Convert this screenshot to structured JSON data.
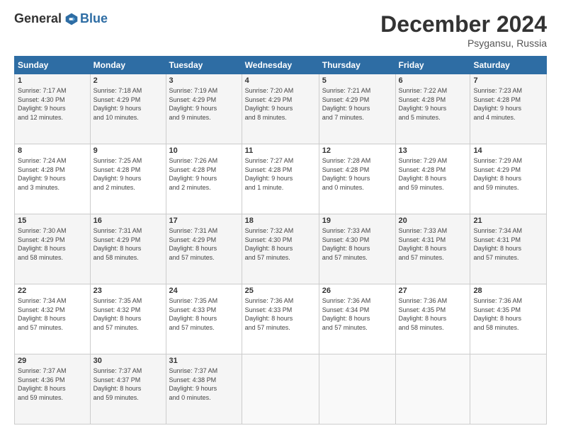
{
  "logo": {
    "general": "General",
    "blue": "Blue"
  },
  "header": {
    "month": "December 2024",
    "location": "Psygansu, Russia"
  },
  "weekdays": [
    "Sunday",
    "Monday",
    "Tuesday",
    "Wednesday",
    "Thursday",
    "Friday",
    "Saturday"
  ],
  "weeks": [
    [
      {
        "day": "1",
        "info": "Sunrise: 7:17 AM\nSunset: 4:30 PM\nDaylight: 9 hours\nand 12 minutes."
      },
      {
        "day": "2",
        "info": "Sunrise: 7:18 AM\nSunset: 4:29 PM\nDaylight: 9 hours\nand 10 minutes."
      },
      {
        "day": "3",
        "info": "Sunrise: 7:19 AM\nSunset: 4:29 PM\nDaylight: 9 hours\nand 9 minutes."
      },
      {
        "day": "4",
        "info": "Sunrise: 7:20 AM\nSunset: 4:29 PM\nDaylight: 9 hours\nand 8 minutes."
      },
      {
        "day": "5",
        "info": "Sunrise: 7:21 AM\nSunset: 4:29 PM\nDaylight: 9 hours\nand 7 minutes."
      },
      {
        "day": "6",
        "info": "Sunrise: 7:22 AM\nSunset: 4:28 PM\nDaylight: 9 hours\nand 5 minutes."
      },
      {
        "day": "7",
        "info": "Sunrise: 7:23 AM\nSunset: 4:28 PM\nDaylight: 9 hours\nand 4 minutes."
      }
    ],
    [
      {
        "day": "8",
        "info": "Sunrise: 7:24 AM\nSunset: 4:28 PM\nDaylight: 9 hours\nand 3 minutes."
      },
      {
        "day": "9",
        "info": "Sunrise: 7:25 AM\nSunset: 4:28 PM\nDaylight: 9 hours\nand 2 minutes."
      },
      {
        "day": "10",
        "info": "Sunrise: 7:26 AM\nSunset: 4:28 PM\nDaylight: 9 hours\nand 2 minutes."
      },
      {
        "day": "11",
        "info": "Sunrise: 7:27 AM\nSunset: 4:28 PM\nDaylight: 9 hours\nand 1 minute."
      },
      {
        "day": "12",
        "info": "Sunrise: 7:28 AM\nSunset: 4:28 PM\nDaylight: 9 hours\nand 0 minutes."
      },
      {
        "day": "13",
        "info": "Sunrise: 7:29 AM\nSunset: 4:28 PM\nDaylight: 8 hours\nand 59 minutes."
      },
      {
        "day": "14",
        "info": "Sunrise: 7:29 AM\nSunset: 4:29 PM\nDaylight: 8 hours\nand 59 minutes."
      }
    ],
    [
      {
        "day": "15",
        "info": "Sunrise: 7:30 AM\nSunset: 4:29 PM\nDaylight: 8 hours\nand 58 minutes."
      },
      {
        "day": "16",
        "info": "Sunrise: 7:31 AM\nSunset: 4:29 PM\nDaylight: 8 hours\nand 58 minutes."
      },
      {
        "day": "17",
        "info": "Sunrise: 7:31 AM\nSunset: 4:29 PM\nDaylight: 8 hours\nand 57 minutes."
      },
      {
        "day": "18",
        "info": "Sunrise: 7:32 AM\nSunset: 4:30 PM\nDaylight: 8 hours\nand 57 minutes."
      },
      {
        "day": "19",
        "info": "Sunrise: 7:33 AM\nSunset: 4:30 PM\nDaylight: 8 hours\nand 57 minutes."
      },
      {
        "day": "20",
        "info": "Sunrise: 7:33 AM\nSunset: 4:31 PM\nDaylight: 8 hours\nand 57 minutes."
      },
      {
        "day": "21",
        "info": "Sunrise: 7:34 AM\nSunset: 4:31 PM\nDaylight: 8 hours\nand 57 minutes."
      }
    ],
    [
      {
        "day": "22",
        "info": "Sunrise: 7:34 AM\nSunset: 4:32 PM\nDaylight: 8 hours\nand 57 minutes."
      },
      {
        "day": "23",
        "info": "Sunrise: 7:35 AM\nSunset: 4:32 PM\nDaylight: 8 hours\nand 57 minutes."
      },
      {
        "day": "24",
        "info": "Sunrise: 7:35 AM\nSunset: 4:33 PM\nDaylight: 8 hours\nand 57 minutes."
      },
      {
        "day": "25",
        "info": "Sunrise: 7:36 AM\nSunset: 4:33 PM\nDaylight: 8 hours\nand 57 minutes."
      },
      {
        "day": "26",
        "info": "Sunrise: 7:36 AM\nSunset: 4:34 PM\nDaylight: 8 hours\nand 57 minutes."
      },
      {
        "day": "27",
        "info": "Sunrise: 7:36 AM\nSunset: 4:35 PM\nDaylight: 8 hours\nand 58 minutes."
      },
      {
        "day": "28",
        "info": "Sunrise: 7:36 AM\nSunset: 4:35 PM\nDaylight: 8 hours\nand 58 minutes."
      }
    ],
    [
      {
        "day": "29",
        "info": "Sunrise: 7:37 AM\nSunset: 4:36 PM\nDaylight: 8 hours\nand 59 minutes."
      },
      {
        "day": "30",
        "info": "Sunrise: 7:37 AM\nSunset: 4:37 PM\nDaylight: 8 hours\nand 59 minutes."
      },
      {
        "day": "31",
        "info": "Sunrise: 7:37 AM\nSunset: 4:38 PM\nDaylight: 9 hours\nand 0 minutes."
      },
      {
        "day": "",
        "info": ""
      },
      {
        "day": "",
        "info": ""
      },
      {
        "day": "",
        "info": ""
      },
      {
        "day": "",
        "info": ""
      }
    ]
  ]
}
